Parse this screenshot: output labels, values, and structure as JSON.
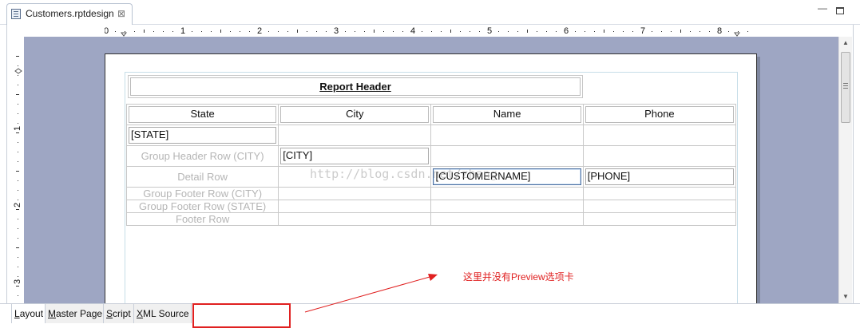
{
  "editor_tab": {
    "label": "Customers.rptdesign",
    "close": "⊠"
  },
  "window": {
    "minimize": "—"
  },
  "ruler": {
    "h_labels": [
      "0",
      "1",
      "2",
      "3",
      "4",
      "5",
      "6",
      "7",
      "8"
    ],
    "v_labels": [
      "1",
      "2",
      "3"
    ]
  },
  "report": {
    "header_title": "Report Header",
    "columns": [
      "State",
      "City",
      "Name",
      "Phone"
    ],
    "state_field": "[STATE]",
    "city_field": "[CITY]",
    "name_field": "[CUSTOMERNAME]",
    "phone_field": "[PHONE]",
    "row_labels": {
      "group_header_city": "Group Header Row (CITY)",
      "detail": "Detail Row",
      "group_footer_city": "Group Footer Row (CITY)",
      "group_footer_state": "Group Footer Row (STATE)",
      "footer": "Footer Row"
    }
  },
  "watermark": "http://blog.csdn.net/zhang",
  "scrollbar": {
    "up": "▲",
    "down": "▼"
  },
  "bottom_tabs": [
    {
      "mnemonic": "L",
      "rest": "ayout"
    },
    {
      "mnemonic": "M",
      "rest": "aster Page"
    },
    {
      "mnemonic": "S",
      "rest": "cript"
    },
    {
      "mnemonic": "X",
      "rest": "ML Source"
    }
  ],
  "annotation": {
    "text": "这里并没有Preview选项卡",
    "color": "#e02020"
  },
  "colors": {
    "canvas_bg": "#9ea6c3",
    "annotation": "#e02020"
  }
}
